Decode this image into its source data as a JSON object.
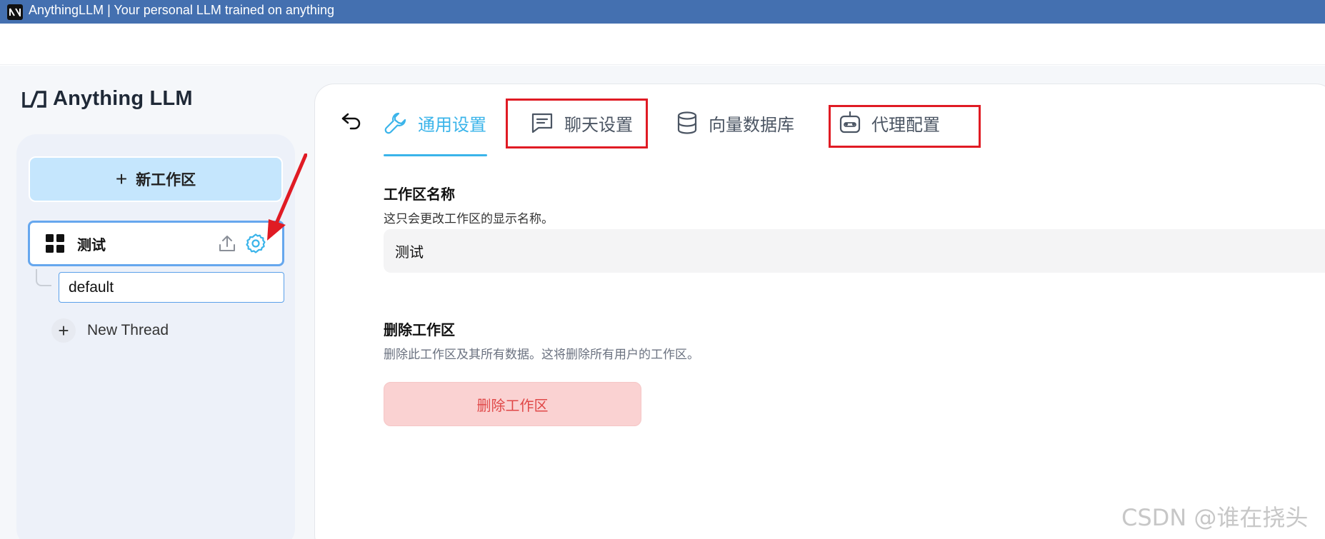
{
  "window": {
    "title": "AnythingLLM | Your personal LLM trained on anything"
  },
  "logo": {
    "text": "Anything LLM"
  },
  "sidebar": {
    "new_workspace_label": "新工作区",
    "workspace": {
      "name": "测试"
    },
    "threads": [
      {
        "label": "default"
      }
    ],
    "new_thread_label": "New Thread"
  },
  "tabs": [
    {
      "label": "通用设置",
      "icon": "wrench-icon",
      "active": true
    },
    {
      "label": "聊天设置",
      "icon": "chat-icon",
      "active": false
    },
    {
      "label": "向量数据库",
      "icon": "database-icon",
      "active": false
    },
    {
      "label": "代理配置",
      "icon": "robot-icon",
      "active": false
    }
  ],
  "general": {
    "name_title": "工作区名称",
    "name_desc": "这只会更改工作区的显示名称。",
    "name_value": "测试",
    "delete_title": "删除工作区",
    "delete_desc": "删除此工作区及其所有数据。这将删除所有用户的工作区。",
    "delete_button": "删除工作区"
  },
  "watermark": "CSDN @谁在挠头",
  "colors": {
    "titlebar": "#4470b0",
    "accent": "#3ab4ea",
    "annotation_red": "#e01b24",
    "danger_bg": "#fad2d2",
    "danger_text": "#e04848"
  }
}
